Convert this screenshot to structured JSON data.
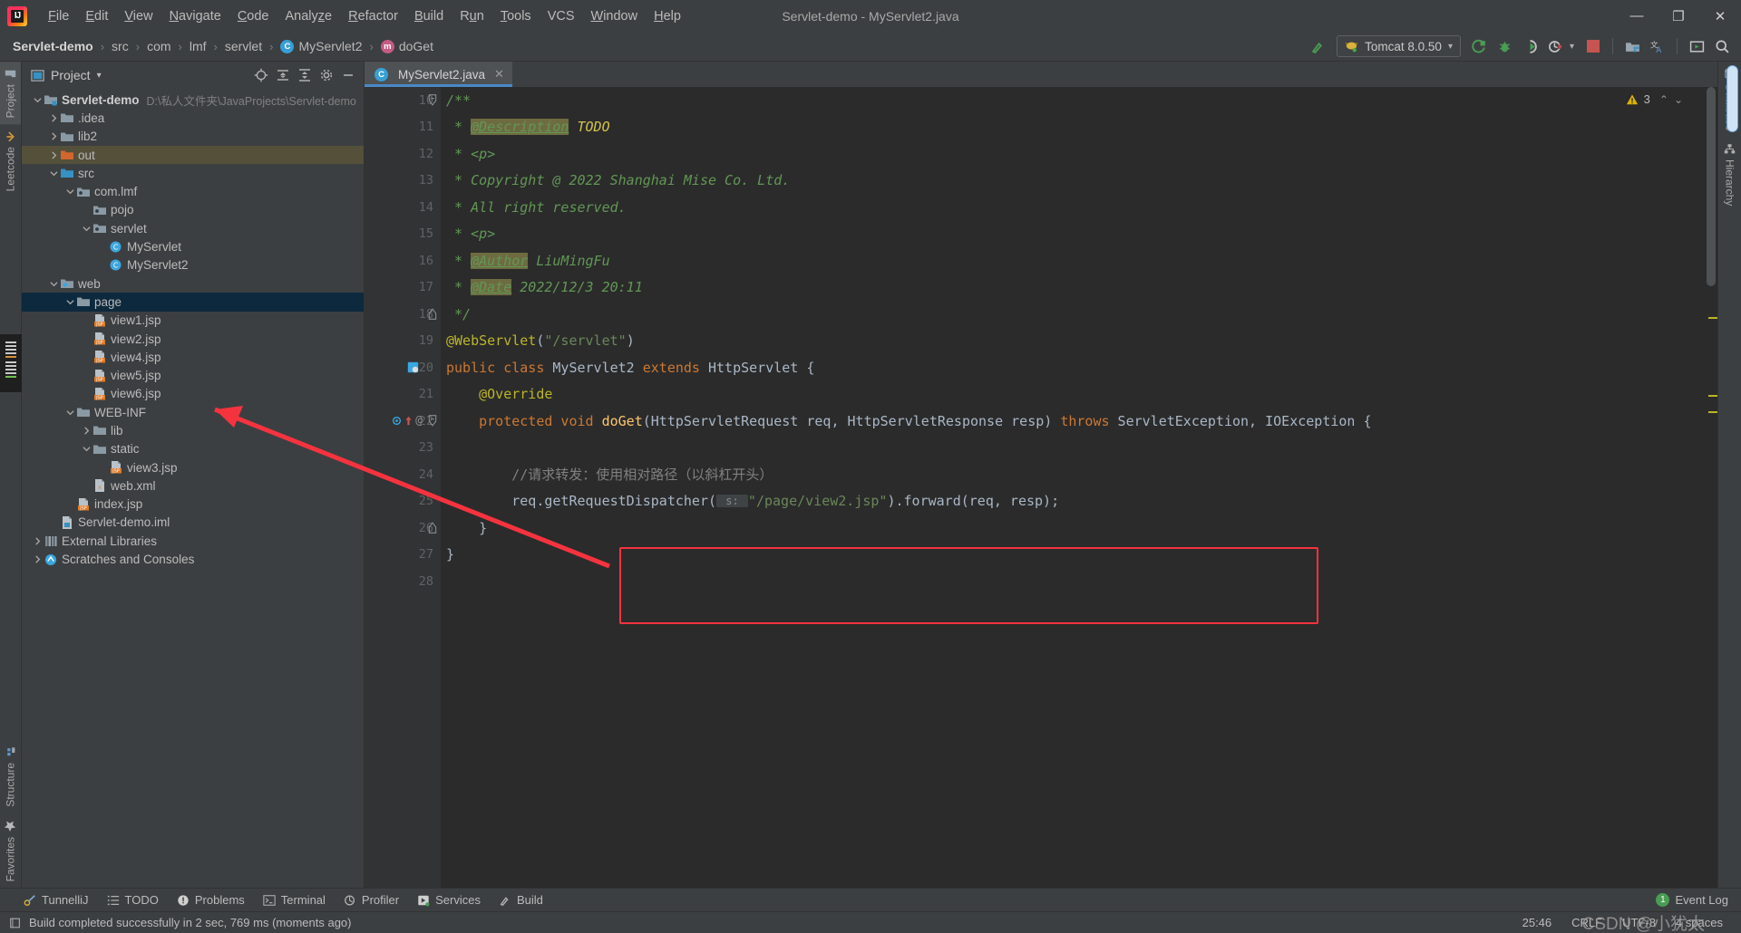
{
  "window": {
    "title": "Servlet-demo - MyServlet2.java",
    "minimize": "—",
    "maximize": "❐",
    "close": "✕"
  },
  "menubar": {
    "items": [
      "File",
      "Edit",
      "View",
      "Navigate",
      "Code",
      "Analyze",
      "Refactor",
      "Build",
      "Run",
      "Tools",
      "VCS",
      "Window",
      "Help"
    ]
  },
  "breadcrumb": {
    "items": [
      {
        "label": "Servlet-demo",
        "icon": "",
        "bold": true
      },
      {
        "label": "src",
        "icon": ""
      },
      {
        "label": "com",
        "icon": ""
      },
      {
        "label": "lmf",
        "icon": ""
      },
      {
        "label": "servlet",
        "icon": ""
      },
      {
        "label": "MyServlet2",
        "icon": "class-icon"
      },
      {
        "label": "doGet",
        "icon": "method-icon"
      }
    ],
    "separator": "›"
  },
  "toolbar": {
    "build_icon": "hammer-icon",
    "run_config": "Tomcat 8.0.50",
    "run_config_dropdown": "▾",
    "run_icon": "run-icon",
    "debug_icon": "debug-icon",
    "run_coverage_icon": "run-coverage-icon",
    "profile_icon": "profile-icon",
    "profile_dropdown": "▾",
    "stop_icon": "stop-icon",
    "project_structure_icon": "project-structure-icon",
    "translate_icon": "translate-icon",
    "preview_icon": "preview-icon",
    "search_icon": "search-icon"
  },
  "left_strip": {
    "top": [
      {
        "label": "Project",
        "icon": "folder-icon",
        "selected": true
      },
      {
        "label": "Leetcode",
        "icon": "leetcode-icon",
        "selected": false
      }
    ],
    "bottom": [
      {
        "label": "Structure",
        "icon": "structure-icon"
      },
      {
        "label": "Favorites",
        "icon": "star-icon"
      }
    ]
  },
  "right_strip": {
    "items": [
      {
        "label": "Database",
        "icon": "database-icon"
      },
      {
        "label": "Hierarchy",
        "icon": "hierarchy-icon"
      }
    ]
  },
  "project_panel": {
    "title": "Project",
    "title_dropdown": "▾",
    "actions": [
      "target-icon",
      "collapse-all-icon",
      "expand-all-icon",
      "settings-icon",
      "hide-icon"
    ],
    "tree": [
      {
        "depth": 0,
        "label": "Servlet-demo",
        "path": "D:\\私人文件夹\\JavaProjects\\Servlet-demo",
        "arrow": "down",
        "icon": "module-folder-icon",
        "bold": true
      },
      {
        "depth": 1,
        "label": ".idea",
        "arrow": "right",
        "icon": "folder-icon"
      },
      {
        "depth": 1,
        "label": "lib2",
        "arrow": "right",
        "icon": "folder-icon"
      },
      {
        "depth": 1,
        "label": "out",
        "arrow": "right",
        "icon": "excluded-folder-icon",
        "rowstate": "warn"
      },
      {
        "depth": 1,
        "label": "src",
        "arrow": "down",
        "icon": "source-folder-icon"
      },
      {
        "depth": 2,
        "label": "com.lmf",
        "arrow": "down",
        "icon": "package-icon"
      },
      {
        "depth": 3,
        "label": "pojo",
        "arrow": "none",
        "icon": "package-icon"
      },
      {
        "depth": 3,
        "label": "servlet",
        "arrow": "down",
        "icon": "package-icon"
      },
      {
        "depth": 4,
        "label": "MyServlet",
        "arrow": "none",
        "icon": "class-icon"
      },
      {
        "depth": 4,
        "label": "MyServlet2",
        "arrow": "none",
        "icon": "class-icon"
      },
      {
        "depth": 1,
        "label": "web",
        "arrow": "down",
        "icon": "web-folder-icon"
      },
      {
        "depth": 2,
        "label": "page",
        "arrow": "down",
        "icon": "folder-icon",
        "rowstate": "sel"
      },
      {
        "depth": 3,
        "label": "view1.jsp",
        "arrow": "none",
        "icon": "jsp-icon"
      },
      {
        "depth": 3,
        "label": "view2.jsp",
        "arrow": "none",
        "icon": "jsp-icon"
      },
      {
        "depth": 3,
        "label": "view4.jsp",
        "arrow": "none",
        "icon": "jsp-icon"
      },
      {
        "depth": 3,
        "label": "view5.jsp",
        "arrow": "none",
        "icon": "jsp-icon"
      },
      {
        "depth": 3,
        "label": "view6.jsp",
        "arrow": "none",
        "icon": "jsp-icon"
      },
      {
        "depth": 2,
        "label": "WEB-INF",
        "arrow": "down",
        "icon": "folder-icon"
      },
      {
        "depth": 3,
        "label": "lib",
        "arrow": "right",
        "icon": "folder-icon"
      },
      {
        "depth": 3,
        "label": "static",
        "arrow": "down",
        "icon": "folder-icon"
      },
      {
        "depth": 4,
        "label": "view3.jsp",
        "arrow": "none",
        "icon": "jsp-icon"
      },
      {
        "depth": 3,
        "label": "web.xml",
        "arrow": "none",
        "icon": "xml-icon"
      },
      {
        "depth": 2,
        "label": "index.jsp",
        "arrow": "none",
        "icon": "jsp-icon"
      },
      {
        "depth": 1,
        "label": "Servlet-demo.iml",
        "arrow": "none",
        "icon": "iml-icon"
      },
      {
        "depth": 0,
        "label": "External Libraries",
        "arrow": "right",
        "icon": "libraries-icon"
      },
      {
        "depth": 0,
        "label": "Scratches and Consoles",
        "arrow": "right",
        "icon": "scratches-icon"
      }
    ]
  },
  "editor": {
    "tab": {
      "label": "MyServlet2.java",
      "icon": "class-icon",
      "close": "✕"
    },
    "inspections": {
      "count": "3",
      "icon": "warning-icon",
      "chevron": "⌄",
      "collapse": "⌃"
    },
    "first_line_number": 10,
    "lines": [
      {
        "n": 10,
        "fold": "start",
        "segs": [
          {
            "t": "/**",
            "c": "jd"
          }
        ]
      },
      {
        "n": 11,
        "segs": [
          {
            "t": " * ",
            "c": "jd"
          },
          {
            "t": "@Description",
            "c": "jdtag"
          },
          {
            "t": " ",
            "c": "jd"
          },
          {
            "t": "TODO",
            "c": "todo"
          }
        ]
      },
      {
        "n": 12,
        "segs": [
          {
            "t": " * <p>",
            "c": "jd"
          }
        ]
      },
      {
        "n": 13,
        "segs": [
          {
            "t": " * Copyright @ 2022 Shanghai Mise Co. Ltd.",
            "c": "jd"
          }
        ]
      },
      {
        "n": 14,
        "segs": [
          {
            "t": " * All right reserved.",
            "c": "jd"
          }
        ]
      },
      {
        "n": 15,
        "segs": [
          {
            "t": " * <p>",
            "c": "jd"
          }
        ]
      },
      {
        "n": 16,
        "segs": [
          {
            "t": " * ",
            "c": "jd"
          },
          {
            "t": "@Author",
            "c": "jdtag"
          },
          {
            "t": " LiuMingFu",
            "c": "jd"
          }
        ]
      },
      {
        "n": 17,
        "segs": [
          {
            "t": " * ",
            "c": "jd"
          },
          {
            "t": "@Date",
            "c": "jdtag"
          },
          {
            "t": " 2022/12/3 20:11",
            "c": "jd"
          }
        ]
      },
      {
        "n": 18,
        "fold": "end",
        "segs": [
          {
            "t": " */",
            "c": "jd"
          }
        ]
      },
      {
        "n": 19,
        "segs": [
          {
            "t": "@WebServlet",
            "c": "ann"
          },
          {
            "t": "(",
            "c": "cls"
          },
          {
            "t": "\"/servlet\"",
            "c": "str"
          },
          {
            "t": ")",
            "c": "cls"
          }
        ]
      },
      {
        "n": 20,
        "gmark": "class-marker",
        "segs": [
          {
            "t": "public class ",
            "c": "kw"
          },
          {
            "t": "MyServlet2 ",
            "c": "cls"
          },
          {
            "t": "extends ",
            "c": "kw"
          },
          {
            "t": "HttpServlet {",
            "c": "cls"
          }
        ]
      },
      {
        "n": 21,
        "segs": [
          {
            "t": "    ",
            "c": "cls"
          },
          {
            "t": "@Override",
            "c": "ann"
          }
        ]
      },
      {
        "n": 22,
        "gmark": "override-marker",
        "fold": "start",
        "segs": [
          {
            "t": "    ",
            "c": "cls"
          },
          {
            "t": "protected void ",
            "c": "kw"
          },
          {
            "t": "doGet",
            "c": "mth"
          },
          {
            "t": "(HttpServletRequest req, HttpServletResponse resp) ",
            "c": "cls"
          },
          {
            "t": "throws ",
            "c": "kw"
          },
          {
            "t": "ServletException, IOException {",
            "c": "cls"
          }
        ]
      },
      {
        "n": 23,
        "segs": []
      },
      {
        "n": 24,
        "segs": [
          {
            "t": "        ",
            "c": "cls"
          },
          {
            "t": "//请求转发：使用相对路径（以斜杠开头）",
            "c": "lcmt"
          }
        ]
      },
      {
        "n": 25,
        "segs": [
          {
            "t": "        req.getRequestDispatcher(",
            "c": "cls"
          },
          {
            "t": " s: ",
            "c": "hint"
          },
          {
            "t": "\"/page/view2.jsp\"",
            "c": "str"
          },
          {
            "t": ").forward(req, resp);",
            "c": "cls"
          }
        ]
      },
      {
        "n": 26,
        "fold": "end",
        "segs": [
          {
            "t": "    }",
            "c": "cls"
          }
        ]
      },
      {
        "n": 27,
        "segs": [
          {
            "t": "}",
            "c": "cls"
          }
        ]
      },
      {
        "n": 28,
        "segs": []
      }
    ]
  },
  "bottom_tabs": [
    {
      "label": "TunnelliJ",
      "icon": "tunnel-icon"
    },
    {
      "label": "TODO",
      "icon": "todo-icon"
    },
    {
      "label": "Problems",
      "icon": "problems-icon"
    },
    {
      "label": "Terminal",
      "icon": "terminal-icon"
    },
    {
      "label": "Profiler",
      "icon": "profiler-icon"
    },
    {
      "label": "Services",
      "icon": "services-icon"
    },
    {
      "label": "Build",
      "icon": "build-icon"
    }
  ],
  "event_log": {
    "count": "1",
    "label": "Event Log"
  },
  "statusbar": {
    "message": "Build completed successfully in 2 sec, 769 ms (moments ago)",
    "icon": "message-icon",
    "caret": "25:46",
    "line_sep": "CRLF",
    "encoding": "UTF-8",
    "indent": "4 spaces"
  },
  "watermark": "CSDN @小犹太",
  "colors": {
    "accent": "#4a88c7",
    "annotation_red": "#f5333f",
    "selection": "#0d293e",
    "warn_row": "#55503a",
    "editor_bg": "#2b2b2b",
    "panel_bg": "#3c3f41"
  }
}
